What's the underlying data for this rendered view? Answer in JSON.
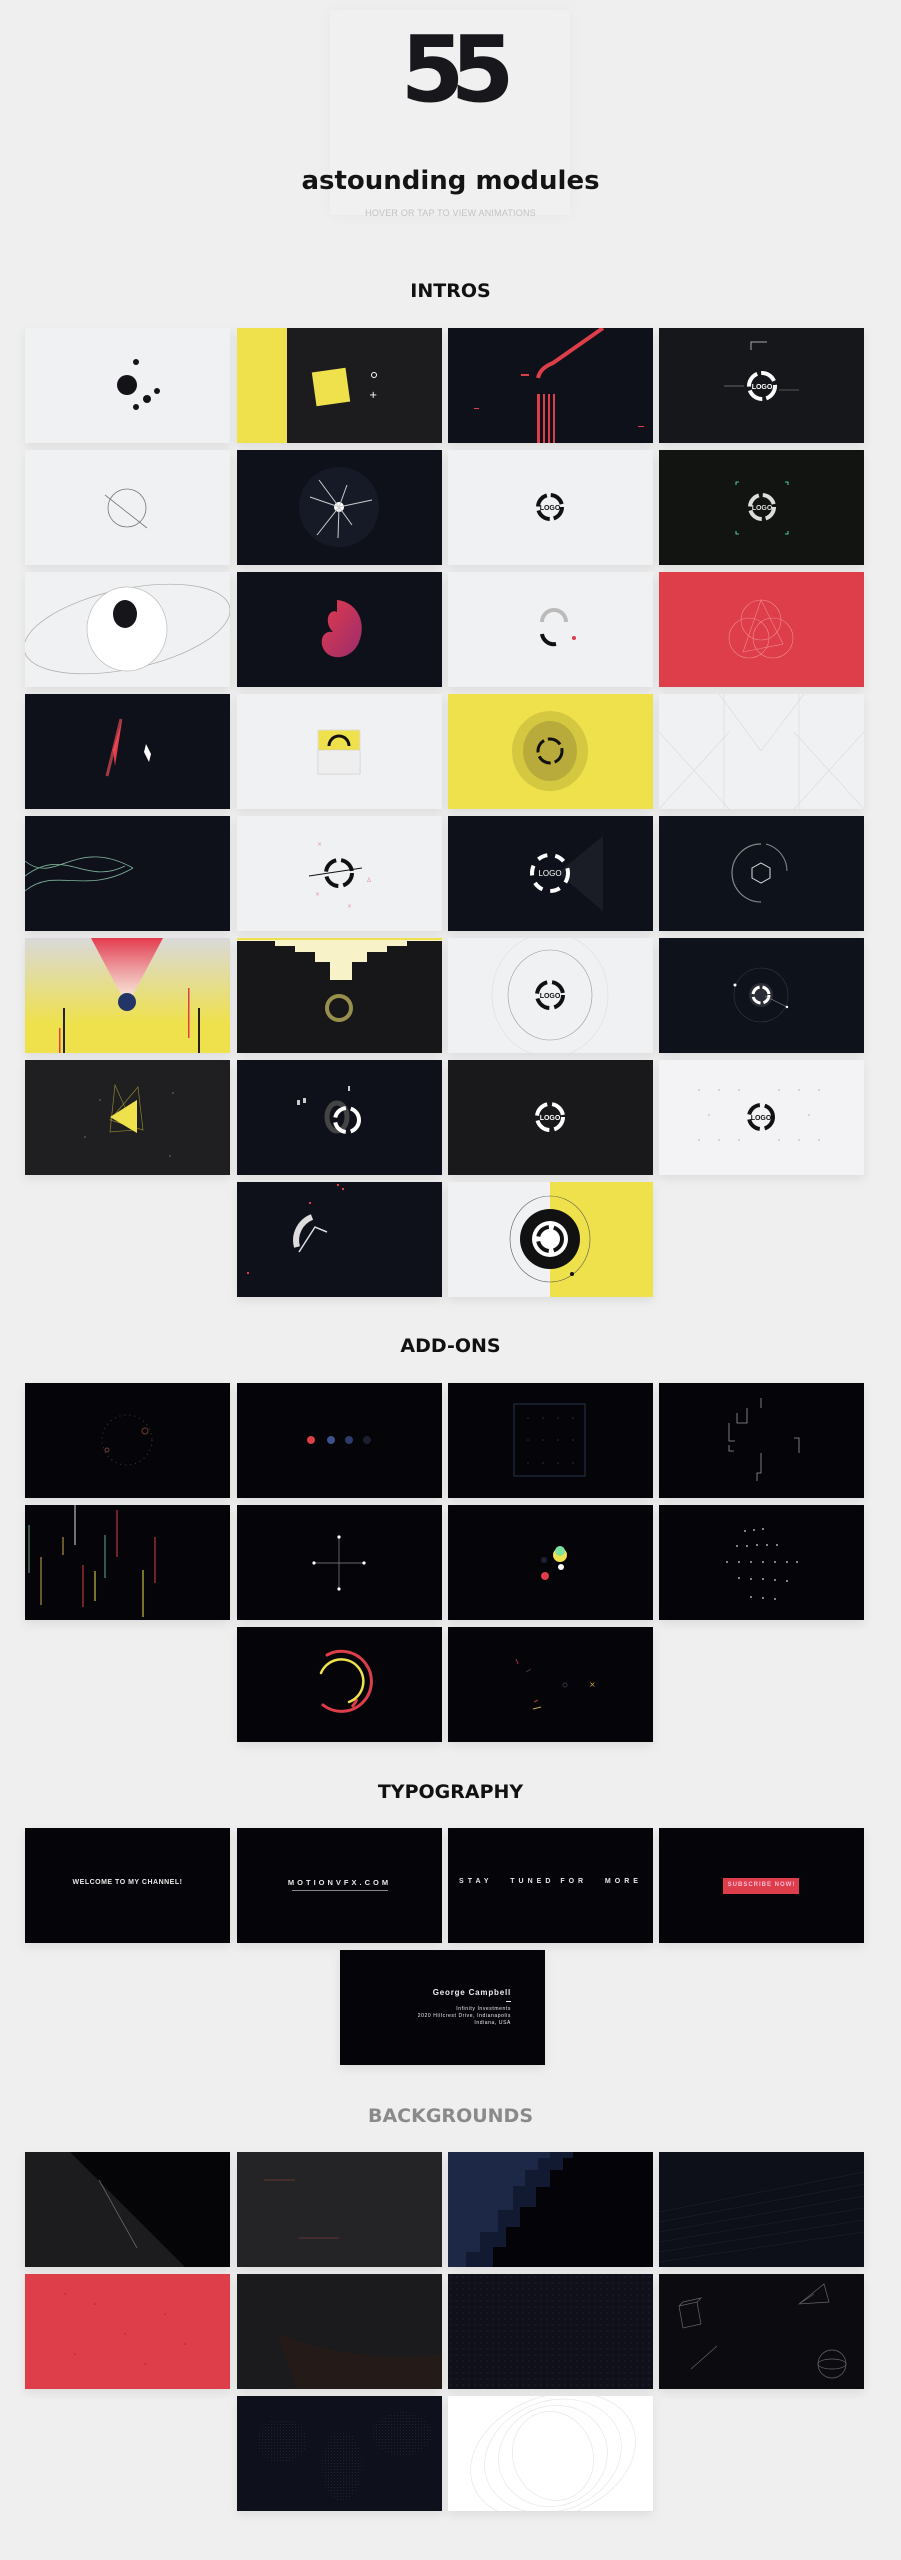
{
  "hero": {
    "number": "55",
    "title": "astounding modules",
    "subtitle": "HOVER OR TAP TO VIEW ANIMATIONS"
  },
  "sections": {
    "intros": {
      "title": "INTROS",
      "count": 30
    },
    "addons": {
      "title": "ADD-ONS",
      "count": 10
    },
    "typography": {
      "title": "TYPOGRAPHY",
      "count": 5
    },
    "backgrounds": {
      "title": "BACKGROUNDS",
      "count": 10
    }
  },
  "logo_text": "LOGO",
  "typography_tiles": {
    "welcome": "WELCOME TO MY CHANNEL!",
    "website": "MOTIONVFX.COM",
    "stay_tuned": "STAY   TUNED FOR   MORE",
    "subscribe": "SUBSCRIBE NOW!",
    "card": {
      "name": "George Campbell",
      "company": "Infinity Investments",
      "address": "2020  Hillcrest Drive, Indianapolis",
      "region": "Indiana, USA"
    }
  },
  "colors": {
    "page_bg": "#efefef",
    "dark_navy": "#0f111a",
    "black": "#050509",
    "yellow": "#efe14b",
    "red": "#dd3e49",
    "light": "#f0f1f3"
  }
}
